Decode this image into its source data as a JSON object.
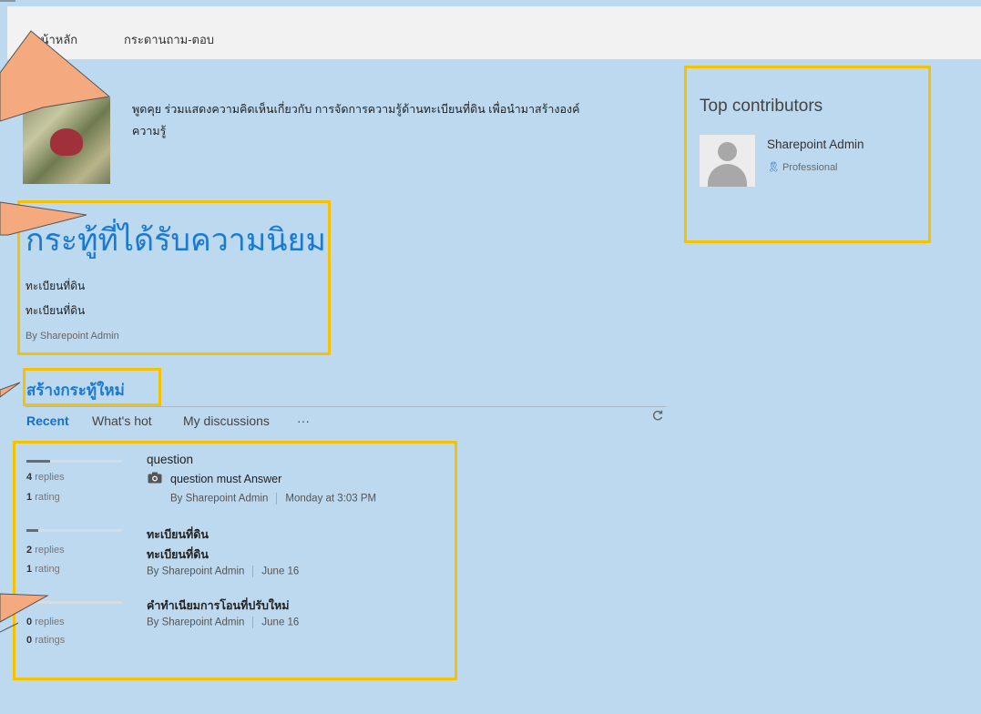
{
  "colors": {
    "page_background": "#bcd9ef",
    "accent_blue": "#1a7ad2",
    "highlight_frame": "#f4c200",
    "callout_fill": "#f4a97f"
  },
  "nav": {
    "home": "หน้าหลัก",
    "forum": "กระดานถาม-ตอบ"
  },
  "intro": {
    "line1": "พูดคุย ร่วมแสดงความคิดเห็นเกี่ยวกับ การจัดการความรู้ด้านทะเบียนที่ดิน เพื่อนำมาสร้างองค์",
    "line2": "ความรู้"
  },
  "popular": {
    "title": "กระทู้ที่ได้รับความนิยม",
    "post_title": "ทะเบียนที่ดิน",
    "post_body": "ทะเบียนที่ดิน",
    "byline": "By Sharepoint Admin"
  },
  "new_topic_label": "สร้างกระทู้ใหม่",
  "tabs": [
    {
      "label": "Recent"
    },
    {
      "label": "What's hot"
    },
    {
      "label": "My discussions"
    },
    {
      "label": "···"
    }
  ],
  "refresh_icon": "refresh-icon",
  "discussions": [
    {
      "activity": 0.25,
      "replies_num": "4",
      "replies_label": "replies",
      "rating_num": "1",
      "rating_label": "rating",
      "title": "question",
      "icon": "camera-icon",
      "body": "question must Answer",
      "author": "By Sharepoint Admin",
      "date": "Monday at 3:03 PM"
    },
    {
      "activity": 0.12,
      "replies_num": "2",
      "replies_label": "replies",
      "rating_num": "1",
      "rating_label": "rating",
      "title": "ทะเบียนที่ดิน",
      "body": "ทะเบียนที่ดิน",
      "author": "By Sharepoint Admin",
      "date": "June 16"
    },
    {
      "activity": 0.02,
      "replies_num": "0",
      "replies_label": "replies",
      "rating_num": "0",
      "rating_label": "ratings",
      "title": "คำทำเนียมการโอนที่ปรับใหม่",
      "author": "By Sharepoint Admin",
      "date": "June 16"
    }
  ],
  "contributors": {
    "title": "Top contributors",
    "items": [
      {
        "name": "Sharepoint Admin",
        "badge": "Professional"
      }
    ]
  }
}
